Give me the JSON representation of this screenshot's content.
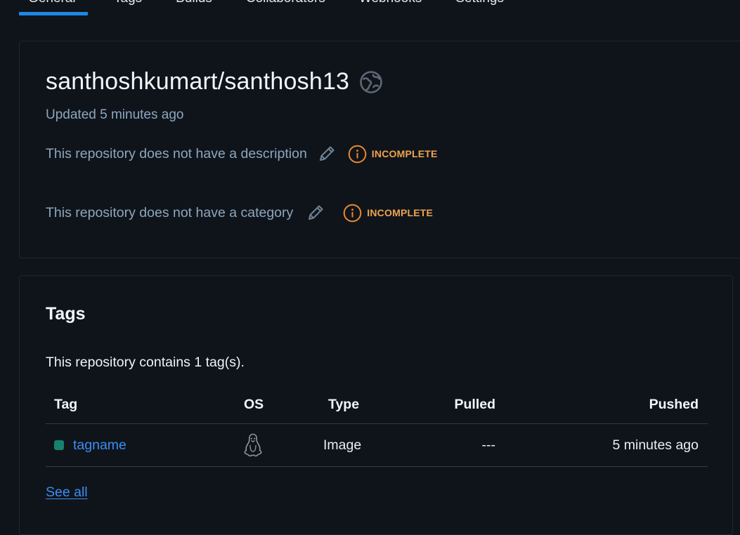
{
  "tabs": [
    {
      "label": "General",
      "active": true
    },
    {
      "label": "Tags",
      "active": false
    },
    {
      "label": "Builds",
      "active": false
    },
    {
      "label": "Collaborators",
      "active": false
    },
    {
      "label": "Webhooks",
      "active": false
    },
    {
      "label": "Settings",
      "active": false
    }
  ],
  "repo": {
    "title": "santhoshkumart/santhosh13",
    "visibility_icon": "globe-icon",
    "updated": "Updated 5 minutes ago",
    "description_text": "This repository does not have a description",
    "description_status": "INCOMPLETE",
    "category_text": "This repository does not have a category",
    "category_status": "INCOMPLETE"
  },
  "tags_section": {
    "heading": "Tags",
    "summary": "This repository contains 1 tag(s).",
    "columns": [
      "Tag",
      "OS",
      "Type",
      "Pulled",
      "Pushed"
    ],
    "rows": [
      {
        "tag": "tagname",
        "status_color": "#17836c",
        "os_icon": "linux-icon",
        "type": "Image",
        "pulled": "---",
        "pushed": "5 minutes ago"
      }
    ],
    "see_all": "See all"
  },
  "colors": {
    "background": "#0f141b",
    "accent": "#1e88e5",
    "link": "#3b8ef2",
    "warning": "#f0a34c",
    "muted_text": "#8ea6bd"
  }
}
